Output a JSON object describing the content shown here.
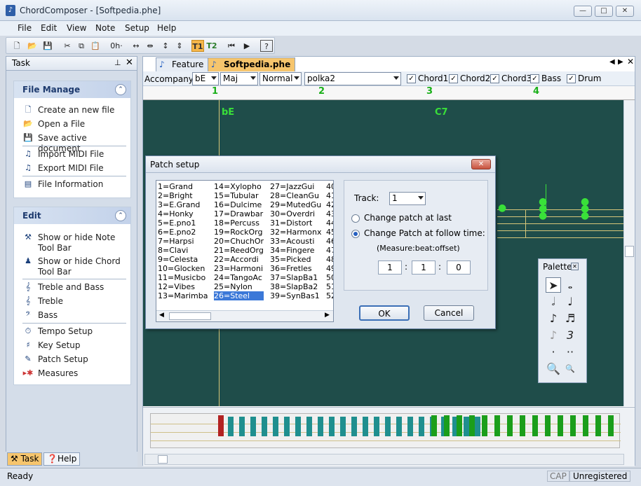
{
  "window": {
    "title": "ChordComposer - [Softpedia.phe]"
  },
  "menu": {
    "items": [
      "File",
      "Edit",
      "View",
      "Note",
      "Setup",
      "Help"
    ]
  },
  "toolbar": {
    "zero_label": "0h·",
    "t1_label": "T1",
    "t2_label": "T2"
  },
  "taskpane": {
    "title": "Task",
    "file_manage": {
      "header": "File Manage",
      "items": [
        "Create an new file",
        "Open a File",
        "Save active document",
        "Import MIDI File",
        "Export MIDI File",
        "File Information"
      ]
    },
    "edit": {
      "header": "Edit",
      "items": [
        "Show or hide Note Tool Bar",
        "Show or hide Chord Tool Bar",
        "Treble and Bass",
        "Treble",
        "Bass",
        "Tempo Setup",
        "Key Setup",
        "Patch Setup",
        "Measures"
      ]
    },
    "tabs": {
      "task": "Task",
      "help": "Help"
    }
  },
  "document": {
    "tabs": [
      "Feature",
      "Softpedia.phe"
    ],
    "accompany_label": "Accompany:",
    "combos": {
      "key": "bE",
      "quality": "Maj",
      "style": "Normal",
      "pattern": "polka2"
    },
    "checks": [
      "Chord1",
      "Chord2",
      "Chord3",
      "Bass",
      "Drum"
    ],
    "ruler": [
      "1",
      "2",
      "3",
      "4"
    ],
    "chords": [
      "bE",
      "C7"
    ]
  },
  "dialog": {
    "title": "Patch setup",
    "patches": [
      [
        "1=Grand",
        "2=Bright",
        "3=E.Grand",
        "4=Honky",
        "5=E.pno1",
        "6=E.pno2",
        "7=Harpsi",
        "8=Clavi",
        "9=Celesta",
        "10=Glocken",
        "11=Musicbo",
        "12=Vibes",
        "13=Marimba"
      ],
      [
        "14=Xylopho",
        "15=Tubular",
        "16=Dulcime",
        "17=Drawbar",
        "18=Percuss",
        "19=RockOrg",
        "20=ChuchOr",
        "21=ReedOrg",
        "22=Accordi",
        "23=Harmoni",
        "24=TangoAc",
        "25=Nylon",
        "26=Steel"
      ],
      [
        "27=JazzGui",
        "28=CleanGu",
        "29=MutedGu",
        "30=Overdri",
        "31=Distort",
        "32=Harmonx",
        "33=Acousti",
        "34=Fingere",
        "35=Picked",
        "36=Fretles",
        "37=SlapBa1",
        "38=SlapBa2",
        "39=SynBas1"
      ],
      [
        "40",
        "41",
        "42",
        "43",
        "44",
        "45",
        "46",
        "47",
        "48",
        "49",
        "50",
        "51",
        "52"
      ]
    ],
    "selected_patch": "26=Steel",
    "track_label": "Track:",
    "track_value": "1",
    "radio_last": "Change patch at last",
    "radio_follow": "Change Patch at follow time:",
    "hint": "(Measure:beat:offset)",
    "measure": "1",
    "beat": "1",
    "offset": "0",
    "ok": "OK",
    "cancel": "Cancel"
  },
  "palette": {
    "title": "Palette"
  },
  "status": {
    "left": "Ready",
    "cap": "CAP",
    "right": "Unregistered"
  }
}
